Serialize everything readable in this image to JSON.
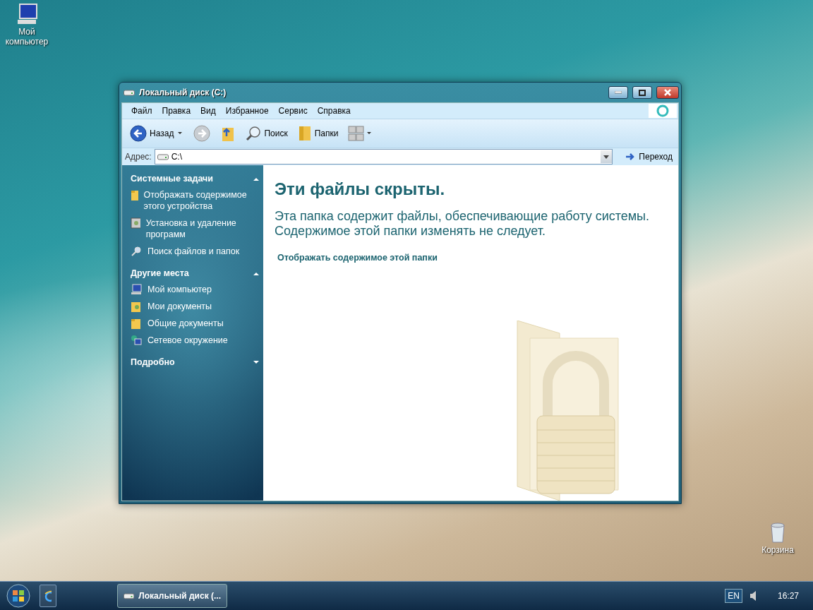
{
  "desktop_icons": [
    {
      "label": "Мой компьютер",
      "kind": "computer"
    },
    {
      "label": "Корзина",
      "kind": "trash"
    }
  ],
  "window": {
    "title": "Локальный диск (C:)",
    "menu": [
      "Файл",
      "Правка",
      "Вид",
      "Избранное",
      "Сервис",
      "Справка"
    ],
    "toolbar": [
      {
        "kind": "back",
        "label": "Назад"
      },
      {
        "kind": "forward"
      },
      {
        "kind": "up"
      },
      {
        "kind": "search",
        "label": "Поиск"
      },
      {
        "kind": "folders",
        "label": "Папки"
      },
      {
        "kind": "views"
      }
    ],
    "address": {
      "label": "Адрес:",
      "value": "C:\\",
      "go": "Переход"
    },
    "sidebar": [
      {
        "title": "Системные задачи",
        "expanded": true,
        "items": [
          {
            "kind": "folder",
            "label": "Отображать содержимое этого устройства"
          },
          {
            "kind": "programs",
            "label": "Установка и удаление программ"
          },
          {
            "kind": "search",
            "label": "Поиск файлов и папок"
          }
        ]
      },
      {
        "title": "Другие места",
        "expanded": true,
        "items": [
          {
            "kind": "computer",
            "label": "Мой компьютер"
          },
          {
            "kind": "documents",
            "label": "Мои документы"
          },
          {
            "kind": "folder",
            "label": "Общие документы"
          },
          {
            "kind": "network",
            "label": "Сетевое окружение"
          }
        ]
      },
      {
        "title": "Подробно",
        "expanded": false
      }
    ],
    "content": {
      "heading": "Эти файлы скрыты.",
      "text": "Эта папка содержит файлы, обеспечивающие работу системы. Содержимое этой папки изменять не следует.",
      "link": "Отображать содержимое этой папки"
    }
  },
  "taskbar": {
    "tasks": [
      {
        "label": "Локальный диск (..."
      }
    ],
    "language": "EN",
    "time": "16:27"
  }
}
